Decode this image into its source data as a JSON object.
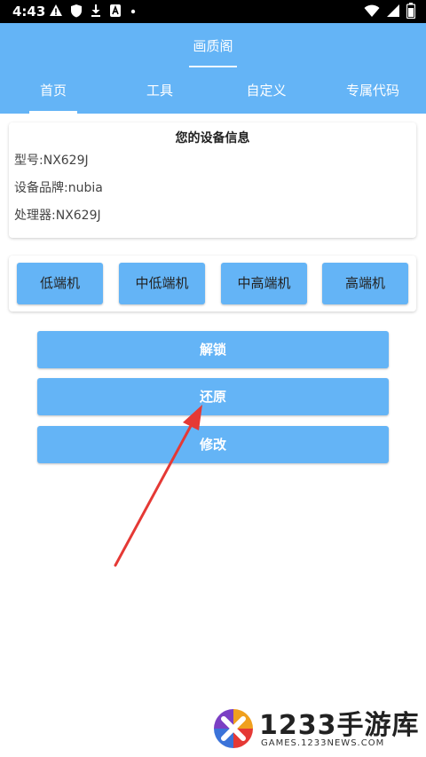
{
  "status_bar": {
    "time": "4:43",
    "icons_left": [
      "warning-icon",
      "shield-icon",
      "download-icon",
      "a-icon",
      "dot-icon"
    ],
    "icons_right": [
      "wifi-icon",
      "signal-icon",
      "battery-icon"
    ]
  },
  "header": {
    "title": "画质阁",
    "tabs": [
      {
        "label": "首页",
        "active": true
      },
      {
        "label": "工具",
        "active": false
      },
      {
        "label": "自定义",
        "active": false
      },
      {
        "label": "专属代码",
        "active": false
      }
    ]
  },
  "device_info": {
    "title": "您的设备信息",
    "model": "型号:NX629J",
    "brand": "设备品牌:nubia",
    "processor": "处理器:NX629J"
  },
  "tiers": [
    {
      "label": "低端机"
    },
    {
      "label": "中低端机"
    },
    {
      "label": "中高端机"
    },
    {
      "label": "高端机"
    }
  ],
  "actions": {
    "unlock": "解锁",
    "restore": "还原",
    "modify": "修改"
  },
  "watermark": {
    "brand": "1233手游库",
    "url": "GAMES.1233NEWS.COM"
  },
  "colors": {
    "primary": "#64b4f6",
    "arrow": "#e53935"
  }
}
